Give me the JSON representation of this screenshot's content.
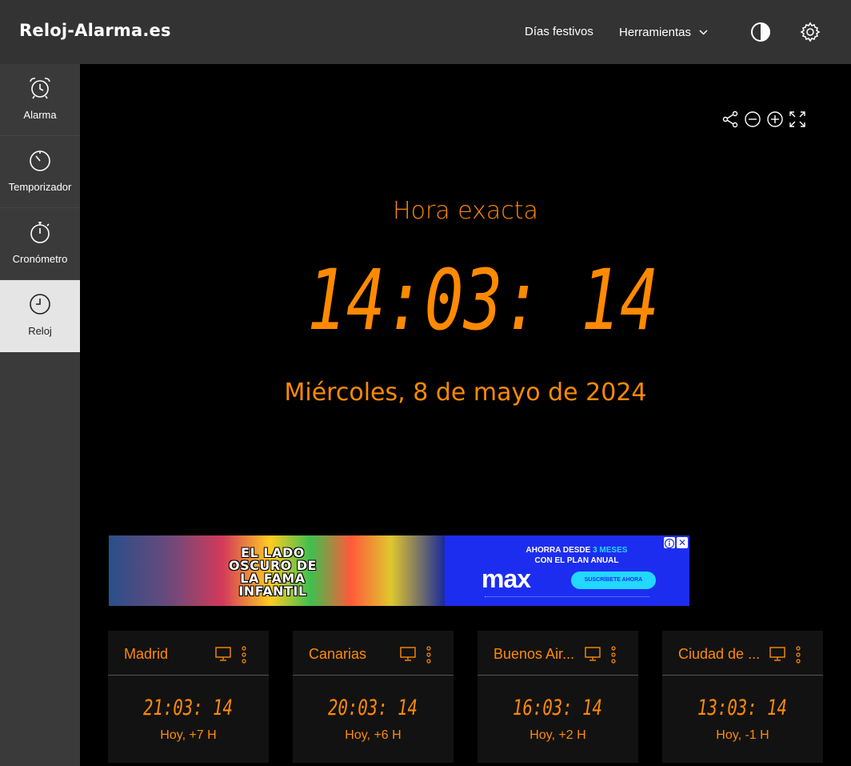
{
  "header": {
    "logo": "Reloj-Alarma.es",
    "nav_festivos": "Días festivos",
    "nav_tools": "Herramientas"
  },
  "sidebar": {
    "items": [
      {
        "label": "Alarma",
        "icon": "alarm-clock-icon"
      },
      {
        "label": "Temporizador",
        "icon": "timer-icon"
      },
      {
        "label": "Cronómetro",
        "icon": "stopwatch-icon"
      },
      {
        "label": "Reloj",
        "icon": "clock-icon",
        "active": true
      }
    ]
  },
  "main": {
    "title": "Hora exacta",
    "time": "14:03: 14",
    "date": "Miércoles, 8 de mayo de 2024",
    "tools": [
      "share-icon",
      "zoom-out-icon",
      "zoom-in-icon",
      "fullscreen-icon"
    ]
  },
  "ad": {
    "title_lines": [
      "EL LADO",
      "OSCURO DE",
      "LA FAMA",
      "INFANTIL"
    ],
    "promo_line1_a": "AHORRA DESDE",
    "promo_line1_b": "3 MESES",
    "promo_line2": "CON EL PLAN ANUAL",
    "brand": "max",
    "cta": "SUSCRÍBETE AHORA",
    "close": "✕"
  },
  "cities": [
    {
      "name": "Madrid",
      "time": "21:03: 14",
      "offset": "Hoy, +7 H"
    },
    {
      "name": "Canarias",
      "time": "20:03: 14",
      "offset": "Hoy, +6 H"
    },
    {
      "name": "Buenos Air...",
      "time": "16:03: 14",
      "offset": "Hoy, +2 H"
    },
    {
      "name": "Ciudad de ...",
      "time": "13:03: 14",
      "offset": "Hoy, -1 H"
    }
  ],
  "colors": {
    "accent": "#ff8a00",
    "topbar": "#333333",
    "sidebar": "#3a3a3a",
    "sidebar_active": "#e5e5e5",
    "background": "#000000",
    "card": "#121212"
  }
}
